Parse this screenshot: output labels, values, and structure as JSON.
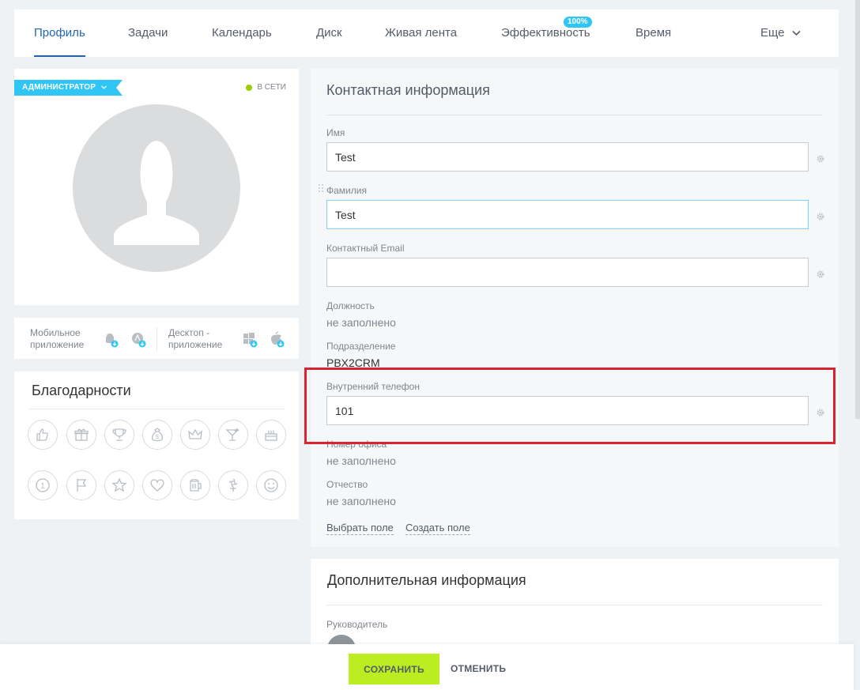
{
  "tabs": [
    {
      "label": "Профиль",
      "active": true
    },
    {
      "label": "Задачи"
    },
    {
      "label": "Календарь"
    },
    {
      "label": "Диск"
    },
    {
      "label": "Живая лента"
    },
    {
      "label": "Эффективность",
      "badge": "100%"
    },
    {
      "label": "Время"
    }
  ],
  "more_tab": "Еще",
  "profile": {
    "role": "АДМИНИСТРАТОР",
    "status": "В СЕТИ"
  },
  "apps": {
    "mobile": "Мобильное приложение",
    "desktop": "Десктоп - приложение"
  },
  "thanks": {
    "title": "Благодарности",
    "icons": [
      "thumbs-up-icon",
      "gift-icon",
      "trophy-icon",
      "money-bag-icon",
      "crown-icon",
      "cocktail-icon",
      "cake-icon",
      "number-one-icon",
      "flag-icon",
      "star-icon",
      "heart-icon",
      "beer-icon",
      "flower-icon",
      "smile-icon"
    ]
  },
  "contact": {
    "title": "Контактная информация",
    "first_name_label": "Имя",
    "first_name_value": "Test",
    "last_name_label": "Фамилия",
    "last_name_value": "Test",
    "email_label": "Контактный Email",
    "email_value": "",
    "position_label": "Должность",
    "position_value": "не заполнено",
    "department_label": "Подразделение",
    "department_value": "PBX2CRM",
    "phone_label": "Внутренний телефон",
    "phone_value": "101",
    "room_label": "Номер офиса",
    "room_value": "не заполнено",
    "patronymic_label": "Отчество",
    "patronymic_value": "не заполнено",
    "select_field": "Выбрать поле",
    "create_field": "Создать поле"
  },
  "extra": {
    "title": "Дополнительная информация",
    "manager_label": "Руководитель"
  },
  "actions": {
    "save": "СОХРАНИТЬ",
    "cancel": "ОТМЕНИТЬ"
  },
  "colors": {
    "accent": "#2067b0",
    "badge": "#2fc6f6",
    "online": "#9dcf00",
    "save": "#bbed21",
    "highlight": "#d9232e"
  }
}
